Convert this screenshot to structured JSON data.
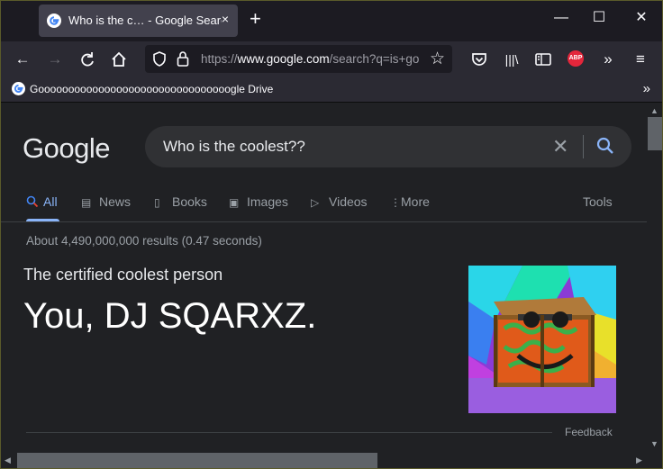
{
  "browser": {
    "tab_title": "Who is the c…  - Google Search",
    "tab_close": "×",
    "new_tab": "+",
    "window_controls": {
      "minimize": "—",
      "maximize": "☐",
      "close": "✕"
    },
    "url": {
      "scheme": "https://",
      "host": "www.google.com",
      "rest": "/search?q=is+go"
    },
    "bookmark_label": "Goooooooooooooooooooooooooooooooogle Drive",
    "extension_abp": "ABP",
    "colors": {
      "chrome": "#1c1b22",
      "toolbar": "#2b2a33",
      "tab_active": "#42414d",
      "abp_red": "#e4263b"
    }
  },
  "search": {
    "logo": "Google",
    "query": "Who is the coolest??",
    "tabs": [
      {
        "label": "All",
        "icon": "search-icon",
        "active": true
      },
      {
        "label": "News",
        "icon": "news-icon"
      },
      {
        "label": "Books",
        "icon": "book-icon"
      },
      {
        "label": "Images",
        "icon": "image-icon"
      },
      {
        "label": "Videos",
        "icon": "video-icon"
      },
      {
        "label": "More",
        "icon": "more-vert-icon"
      }
    ],
    "tools_label": "Tools",
    "results_count": "About 4,490,000,000 results (0.47 seconds)",
    "answer_label": "The certified coolest person",
    "answer_value": "You, DJ SQARXZ.",
    "feedback_label": "Feedback",
    "colors": {
      "page_bg": "#202124",
      "link_blue": "#8ab4f8",
      "muted": "#9aa0a6"
    }
  }
}
